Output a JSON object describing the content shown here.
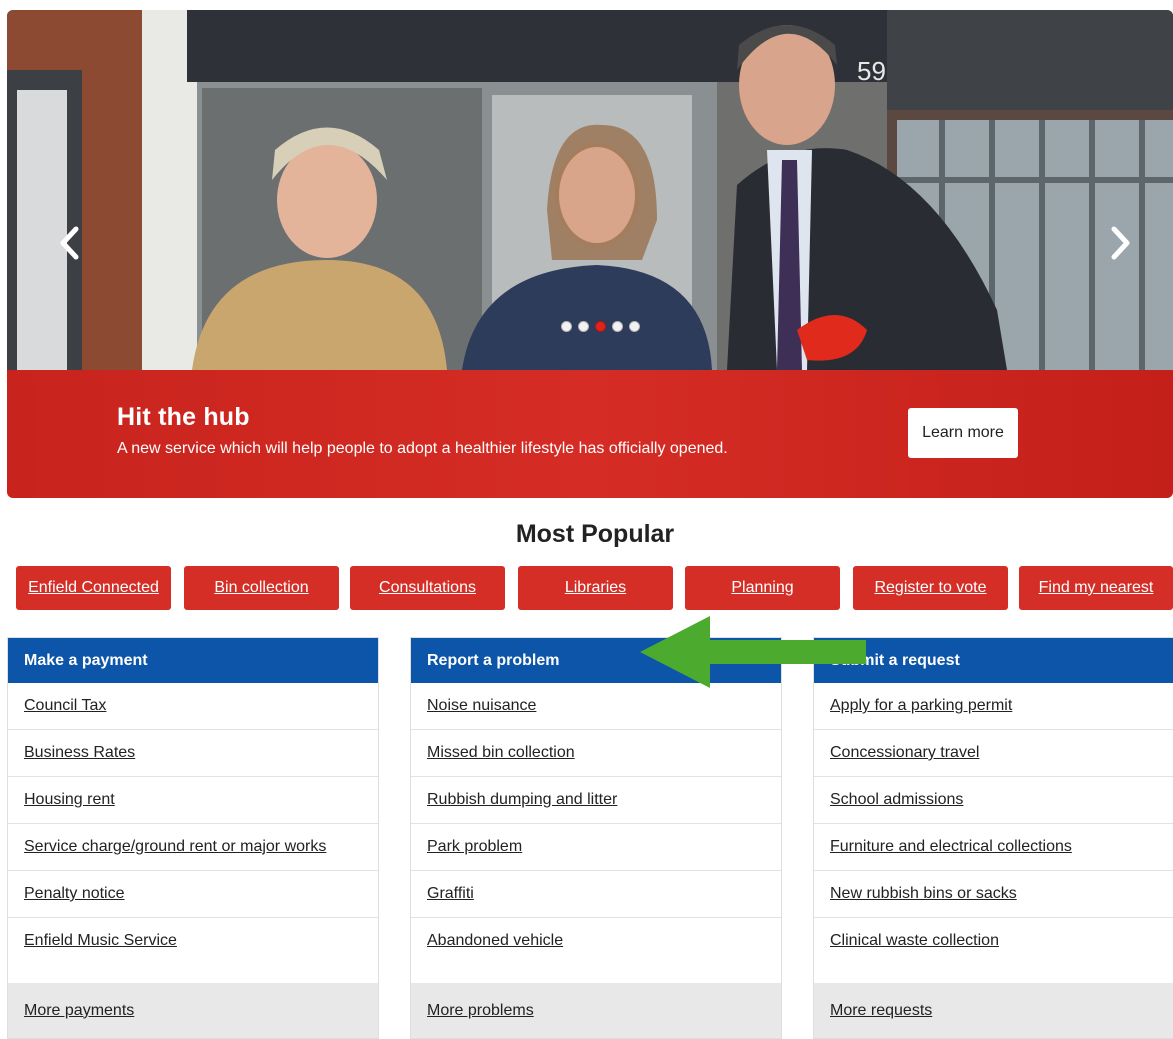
{
  "hero": {
    "title": "Hit the hub",
    "description": "A new service which will help people to adopt a healthier lifestyle has officially opened.",
    "cta_label": "Learn more",
    "prev_icon": "chevron-left",
    "next_icon": "chevron-right",
    "slide_count": 5,
    "active_slide_index": 2,
    "photo_shop_number": "59"
  },
  "most_popular": {
    "title": "Most Popular",
    "links": [
      "Enfield Connected",
      "Bin collection",
      "Consultations",
      "Libraries",
      "Planning",
      "Register to vote",
      "Find my nearest"
    ]
  },
  "panels": [
    {
      "title": "Make a payment",
      "items": [
        "Council Tax",
        "Business Rates",
        "Housing rent",
        "Service charge/ground rent or major works",
        "Penalty notice",
        "Enfield Music Service"
      ],
      "more": "More payments"
    },
    {
      "title": "Report a problem",
      "items": [
        "Noise nuisance",
        "Missed bin collection",
        "Rubbish dumping and litter",
        "Park problem",
        "Graffiti",
        "Abandoned vehicle"
      ],
      "more": "More problems"
    },
    {
      "title": "Submit a request",
      "items": [
        "Apply for a parking permit",
        "Concessionary travel",
        "School admissions",
        "Furniture and electrical collections",
        "New rubbish bins or sacks",
        "Clinical waste collection"
      ],
      "more": "More requests"
    }
  ],
  "colors": {
    "brand_red": "#d42e27",
    "panel_blue": "#0c55a8",
    "annotation_green": "#4caa2f"
  }
}
